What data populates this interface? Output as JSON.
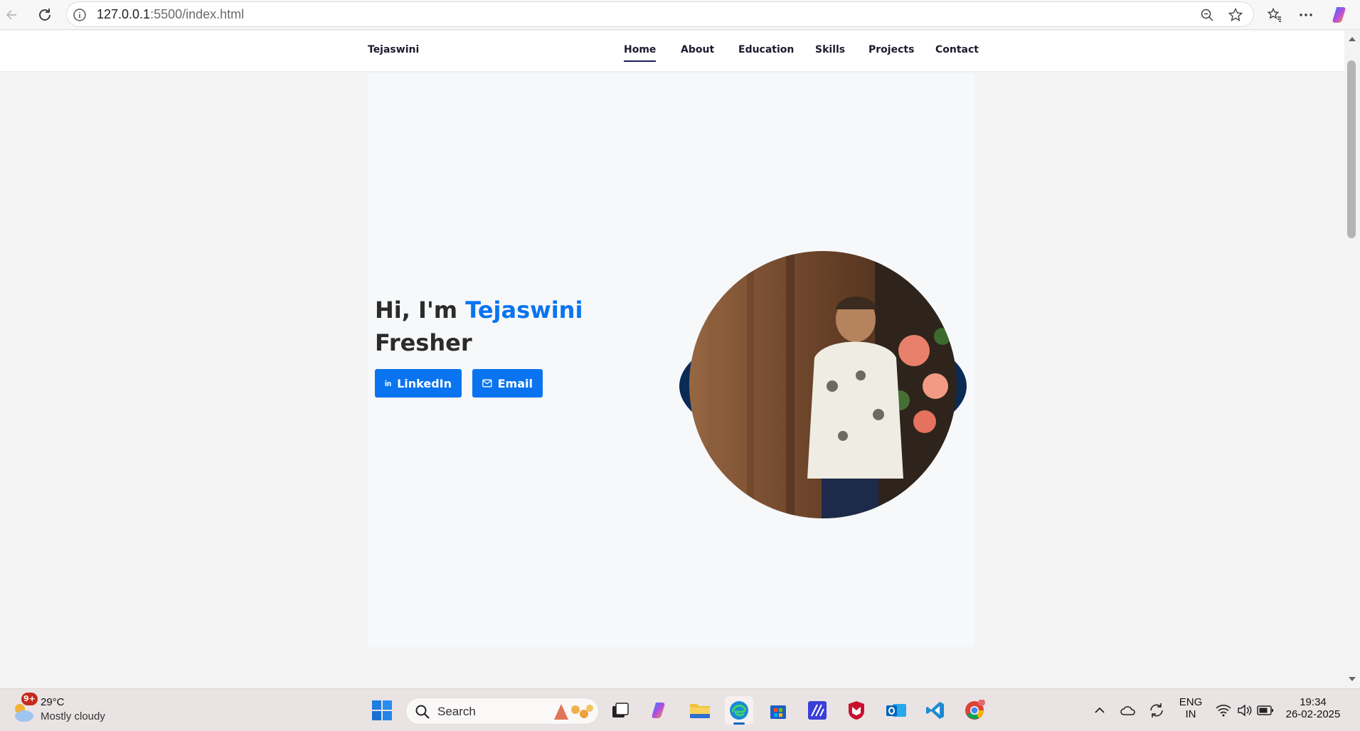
{
  "browser": {
    "url_host": "127.0.0.1",
    "url_rest": ":5500/index.html"
  },
  "site": {
    "brand": "Tejaswini",
    "nav": [
      "Home",
      "About",
      "Education",
      "Skills",
      "Projects",
      "Contact"
    ],
    "active_nav": "Home",
    "hero": {
      "greeting": "Hi, I'm ",
      "name": "Tejaswini",
      "role": "Fresher",
      "linkedin_label": "LinkedIn",
      "email_label": "Email"
    },
    "colors": {
      "accent": "#0a74f0",
      "portrait_ring": "#0b2b55"
    }
  },
  "taskbar": {
    "weather_temp": "29°C",
    "weather_cond": "Mostly cloudy",
    "weather_badge": "9+",
    "search_label": "Search",
    "lang_1": "ENG",
    "lang_2": "IN",
    "time": "19:34",
    "date": "26-02-2025"
  }
}
